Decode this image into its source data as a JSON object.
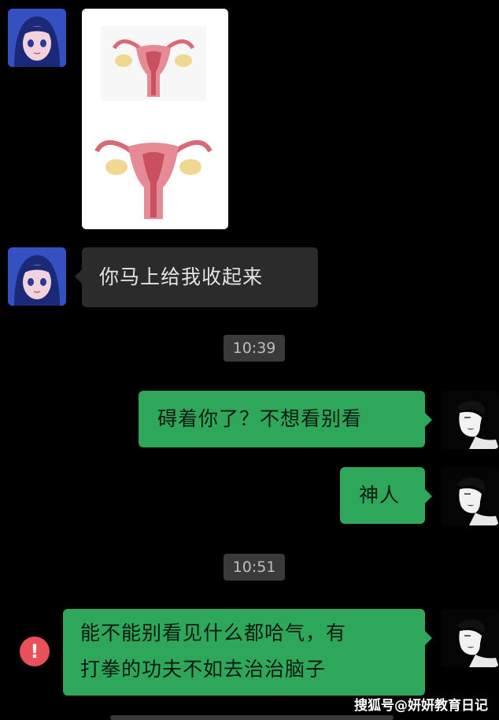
{
  "chat": {
    "messages": [
      {
        "side": "left",
        "type": "image",
        "alt": "uterus-diagram"
      },
      {
        "side": "left",
        "type": "text",
        "text": "你马上给我收起来"
      },
      {
        "type": "time",
        "text": "10:39"
      },
      {
        "side": "right",
        "type": "text",
        "text": "碍着你了？不想看别看"
      },
      {
        "side": "right",
        "type": "text",
        "text": "神人"
      },
      {
        "type": "time",
        "text": "10:51"
      },
      {
        "side": "right",
        "type": "text",
        "lines": [
          "能不能别看见什么都哈气，有",
          "打拳的功夫不如去治治脑子"
        ],
        "status": "failed"
      }
    ]
  },
  "watermark": "搜狐号@妍妍教育日记",
  "colors": {
    "background": "#000000",
    "incoming_bubble": "#2b2b2b",
    "outgoing_bubble": "#2fa75a",
    "error_badge": "#e8505a"
  },
  "icons": {
    "error": "exclamation-circle-icon"
  },
  "error_badge_text": "!"
}
